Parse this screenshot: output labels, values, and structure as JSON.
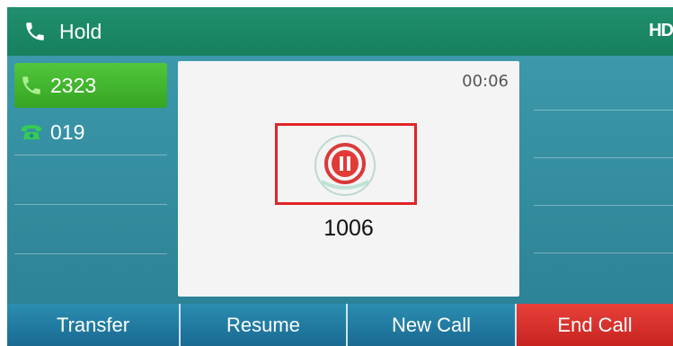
{
  "header": {
    "title": "Hold",
    "hd_badge": "HD"
  },
  "lines": [
    {
      "label": "2323",
      "active": true,
      "icon": "phone-handset-icon"
    },
    {
      "label": "019",
      "active": false,
      "icon": "desk-phone-icon"
    }
  ],
  "call": {
    "timer": "00:06",
    "number": "1006",
    "status_icon": "pause-icon"
  },
  "softkeys": {
    "transfer": "Transfer",
    "resume": "Resume",
    "new_call": "New Call",
    "end_call": "End Call"
  },
  "colors": {
    "topbar": "#1f8f6e",
    "active_line": "#3fb32a",
    "end_call": "#d9302b",
    "softkey": "#2277a0",
    "hold_highlight": "#e02525"
  }
}
